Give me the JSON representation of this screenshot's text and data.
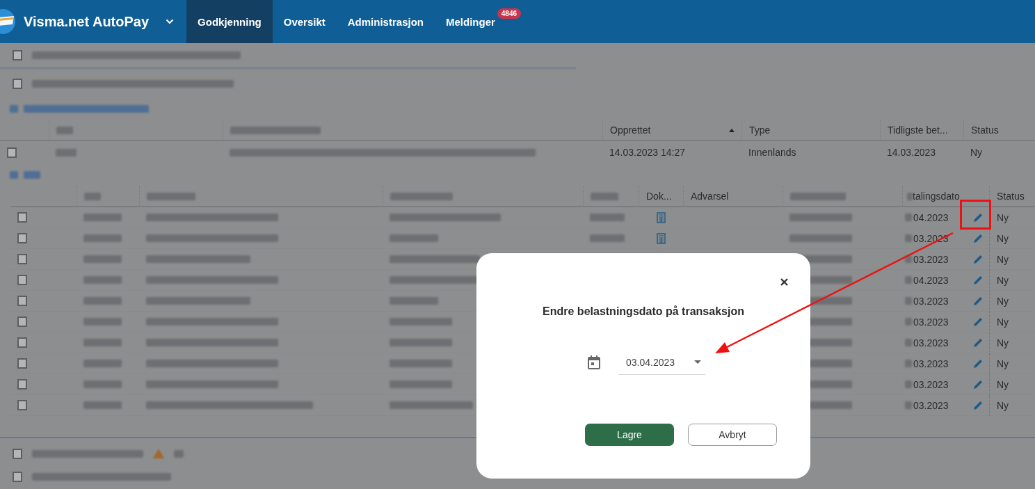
{
  "app": {
    "title": "Visma.net AutoPay"
  },
  "nav": [
    {
      "label": "Godkjenning",
      "selected": true
    },
    {
      "label": "Oversikt",
      "selected": false
    },
    {
      "label": "Administrasjon",
      "selected": false
    },
    {
      "label": "Meldinger",
      "selected": false,
      "badge": "4846"
    }
  ],
  "groups_top": [
    {
      "checked": false
    },
    {
      "checked": false
    }
  ],
  "batch_table": {
    "columns": [
      "Opprettet",
      "Type",
      "Tidligste bet...",
      "Status"
    ],
    "rows": [
      {
        "checked": false,
        "created": "14.03.2023 14:27",
        "type": "Innenlands",
        "earliest": "14.03.2023",
        "status": "Ny"
      }
    ]
  },
  "transactions": {
    "columns": [
      "Dok...",
      "Advarsel",
      "talingsdato",
      "Status"
    ],
    "rows": [
      {
        "checked": false,
        "has_doc": true,
        "date": "04.2023",
        "status": "Ny"
      },
      {
        "checked": false,
        "has_doc": true,
        "date": "03.2023",
        "status": "Ny"
      },
      {
        "checked": false,
        "date": "03.2023",
        "status": "Ny"
      },
      {
        "checked": false,
        "date": "04.2023",
        "status": "Ny"
      },
      {
        "checked": false,
        "date": "03.2023",
        "status": "Ny"
      },
      {
        "checked": false,
        "date": "03.2023",
        "status": "Ny"
      },
      {
        "checked": false,
        "date": "03.2023",
        "status": "Ny"
      },
      {
        "checked": false,
        "date": "03.2023",
        "status": "Ny"
      },
      {
        "checked": false,
        "date": "03.2023",
        "status": "Ny"
      },
      {
        "checked": false,
        "date": "03.2023",
        "status": "Ny"
      }
    ]
  },
  "groups_bottom": [
    {
      "checked": false
    },
    {
      "checked": false
    }
  ],
  "dialog": {
    "title": "Endre belastningsdato på transaksjon",
    "date": "03.04.2023",
    "buttons": [
      {
        "label": "Lagre",
        "kind": "primary"
      },
      {
        "label": "Avbryt",
        "kind": "secondary"
      }
    ]
  }
}
